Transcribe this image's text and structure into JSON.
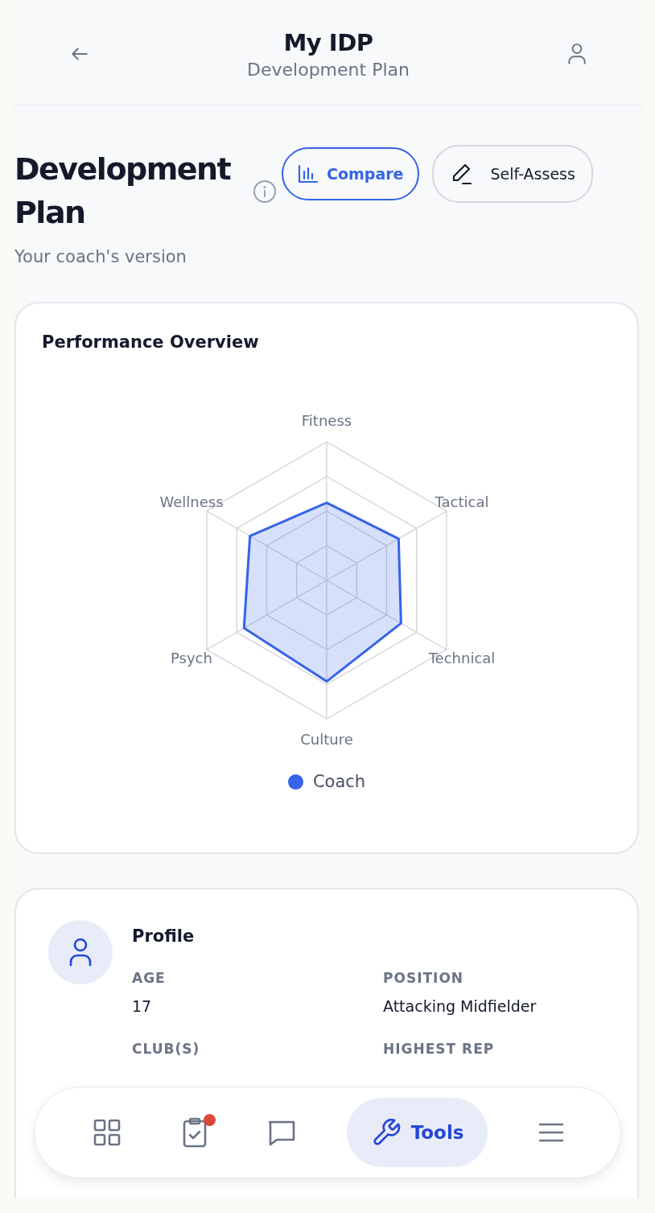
{
  "header": {
    "title": "My IDP",
    "subtitle": "Development Plan"
  },
  "page": {
    "title": "Development Plan",
    "subtitle": "Your coach's version"
  },
  "actions": [
    {
      "kind": "compare",
      "label": "Compare"
    },
    {
      "kind": "edit",
      "label": "Self-Assess"
    }
  ],
  "overview": {
    "title": "Performance Overview",
    "axes": [
      "Fitness",
      "Tactical",
      "Technical",
      "Culture",
      "Psych",
      "Wellness"
    ],
    "legend": [
      {
        "label": "Coach",
        "color": "#3563e9"
      }
    ]
  },
  "profile": {
    "title": "Profile",
    "fields": [
      {
        "label": "AGE",
        "value": "17"
      },
      {
        "label": "POSITION",
        "value": "Attacking Midfielder"
      },
      {
        "label": "CLUB(S)"
      },
      {
        "label": "HIGHEST REP"
      }
    ]
  },
  "nav": [
    {
      "kind": "dashboard",
      "selected": false,
      "badge": false
    },
    {
      "kind": "tasks",
      "selected": false,
      "badge": true
    },
    {
      "kind": "messages",
      "selected": false,
      "badge": false
    },
    {
      "kind": "tools",
      "label": "Tools",
      "selected": true,
      "badge": false
    },
    {
      "kind": "menu",
      "selected": false,
      "badge": false
    }
  ]
}
